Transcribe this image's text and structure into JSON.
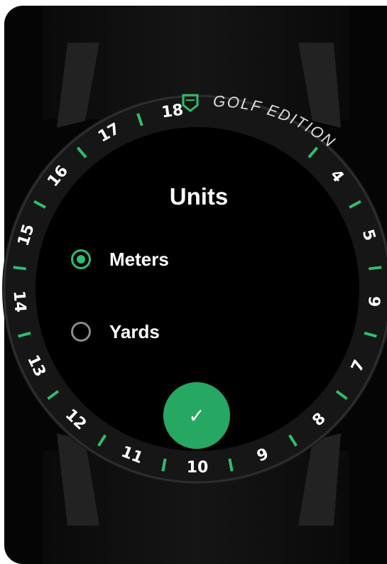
{
  "bezel": {
    "numbers": [
      "18",
      "17",
      "16",
      "15",
      "14",
      "13",
      "12",
      "11",
      "10",
      "9",
      "8",
      "7",
      "6",
      "5",
      "4"
    ],
    "brand_text": "GOLF EDITION",
    "logo_icon": "shield-flag-icon"
  },
  "screen": {
    "title": "Units",
    "options": [
      {
        "label": "Meters",
        "selected": true
      },
      {
        "label": "Yards",
        "selected": false
      }
    ],
    "confirm_icon": "check-icon",
    "confirm_glyph": "✓"
  },
  "colors": {
    "accent": "#2fbd6e",
    "confirm_bg": "#26a862",
    "unselected": "#8a8a8a",
    "bezel_text": "#ffffff"
  }
}
